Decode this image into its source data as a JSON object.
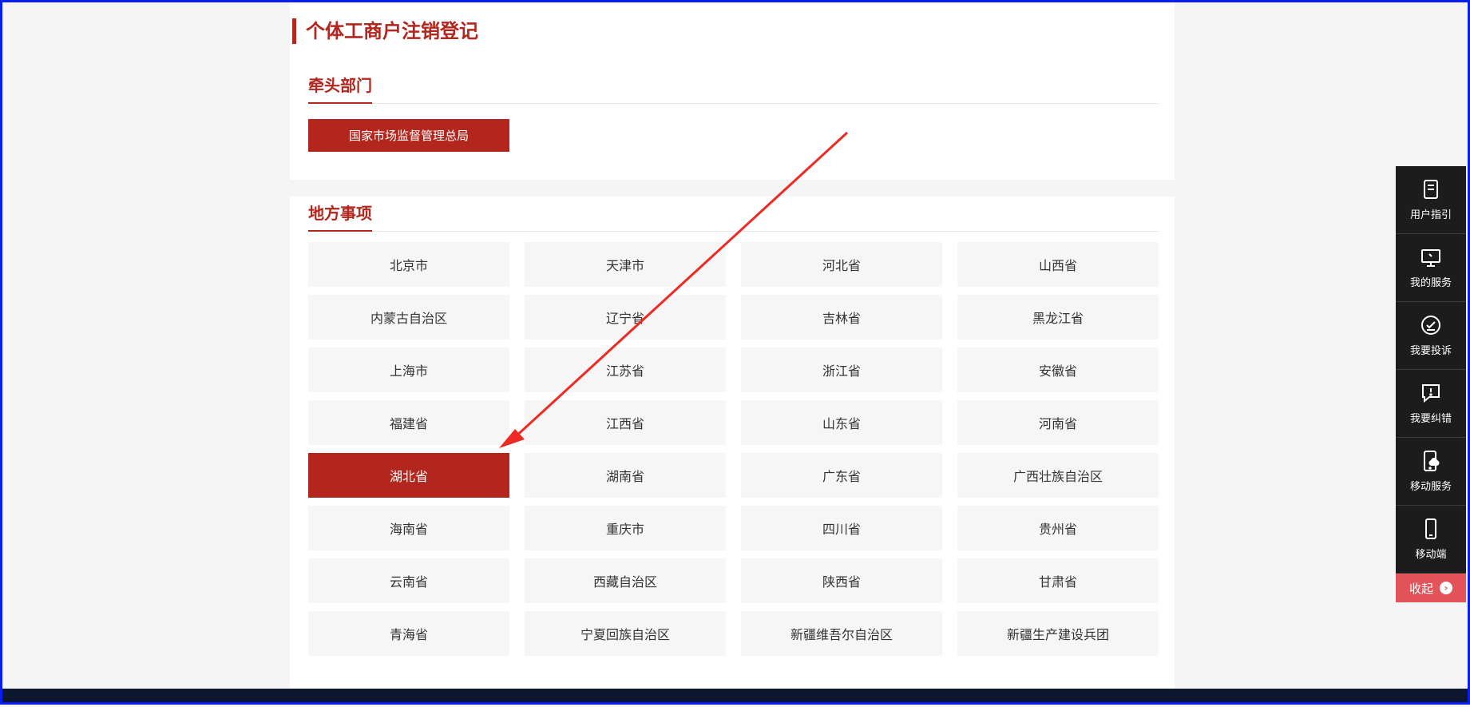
{
  "page_title": "个体工商户注销登记",
  "lead_department": {
    "heading": "牵头部门",
    "button_label": "国家市场监督管理总局"
  },
  "local_items": {
    "heading": "地方事项",
    "selected": "湖北省",
    "regions": [
      "北京市",
      "天津市",
      "河北省",
      "山西省",
      "内蒙古自治区",
      "辽宁省",
      "吉林省",
      "黑龙江省",
      "上海市",
      "江苏省",
      "浙江省",
      "安徽省",
      "福建省",
      "江西省",
      "山东省",
      "河南省",
      "湖北省",
      "湖南省",
      "广东省",
      "广西壮族自治区",
      "海南省",
      "重庆市",
      "四川省",
      "贵州省",
      "云南省",
      "西藏自治区",
      "陕西省",
      "甘肃省",
      "青海省",
      "宁夏回族自治区",
      "新疆维吾尔自治区",
      "新疆生产建设兵团"
    ]
  },
  "sidebar": {
    "items": [
      {
        "label": "用户指引",
        "icon": "guide-icon"
      },
      {
        "label": "我的服务",
        "icon": "monitor-icon"
      },
      {
        "label": "我要投诉",
        "icon": "complaint-icon"
      },
      {
        "label": "我要纠错",
        "icon": "correction-icon"
      },
      {
        "label": "移动服务",
        "icon": "mobile-cloud-icon"
      },
      {
        "label": "移动端",
        "icon": "phone-icon"
      }
    ],
    "collapse_label": "收起",
    "collapse_icon": "arrow-right-circle-icon"
  },
  "colors": {
    "accent": "#b3261e",
    "sidebar_bg": "#1c1c1c",
    "collapse_bg": "#e2535a",
    "annotation_arrow": "#ee2a24",
    "frame_border": "#0a1cf5"
  }
}
